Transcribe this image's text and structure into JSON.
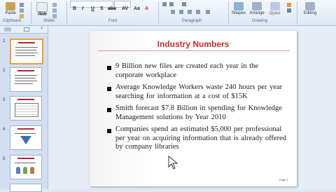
{
  "ribbon": {
    "paste_label": "Paste",
    "new_slide_label": "New",
    "new_slide_sub": "Slide",
    "groups": [
      "Clipboard",
      "Slides",
      "Font",
      "Paragraph",
      "Drawing",
      "Editing"
    ],
    "format_buttons": [
      "B",
      "I",
      "U",
      "S",
      "abc",
      "AV",
      "Aa",
      "A"
    ],
    "drawing_buttons": [
      "Shapes",
      "Arrange",
      "Quick",
      "Styles"
    ],
    "editing_label": "Editing"
  },
  "thumbnails": [
    {
      "num": "1",
      "selected": true
    },
    {
      "num": "2",
      "selected": false
    },
    {
      "num": "3",
      "selected": false
    },
    {
      "num": "4",
      "selected": false
    },
    {
      "num": "5",
      "selected": false
    }
  ],
  "slide": {
    "title": "Industry Numbers",
    "bullets": [
      "9 Billion  new  files  are created each year in the corporate workplace",
      "Average Knowledge Workers waste 240 hours per year searching for information  at a cost of $15K",
      "Smith forecast $7.8 Billion  in spending for Knowledge Management  solutions by Year 2010",
      "Companies spend an estimated  $5,000 per professional per year on acquiring  information  that is already  offered by company libraries"
    ],
    "page_number": "Page 1"
  },
  "colors": {
    "title": "#c0312d",
    "thumb_selected": "#e8a23a",
    "ribbon_bg": "#dde8f5"
  }
}
